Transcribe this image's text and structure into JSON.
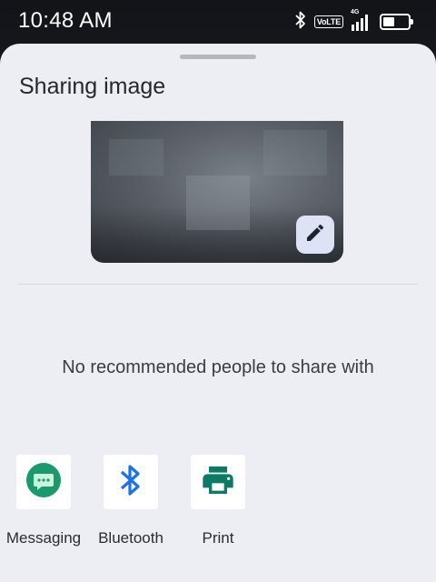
{
  "status_bar": {
    "time": "10:48 AM",
    "network_label": "VoLTE",
    "network_type": "4G",
    "icons": [
      "bluetooth-icon",
      "volte-icon",
      "signal-icon",
      "battery-icon"
    ],
    "battery_level": 0.45
  },
  "share_sheet": {
    "title": "Sharing image",
    "empty_message": "No recommended people to share with",
    "targets": [
      {
        "label": "Messaging",
        "icon": "messaging-icon",
        "color": "#1a9a6c"
      },
      {
        "label": "Bluetooth",
        "icon": "bluetooth-icon",
        "color": "#1a73e8"
      },
      {
        "label": "Print",
        "icon": "printer-icon",
        "color": "#0b7a66"
      }
    ]
  },
  "colors": {
    "sheet_bg": "#eceef4",
    "edit_button_bg": "#dde3f5"
  }
}
